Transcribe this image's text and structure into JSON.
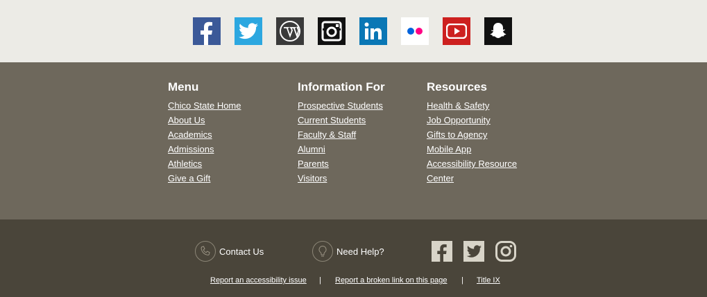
{
  "social_icons": [
    {
      "icon": "facebook-icon",
      "bg": "#3b5998"
    },
    {
      "icon": "twitter-icon",
      "bg": "#2ca7e0"
    },
    {
      "icon": "wordpress-icon",
      "bg": "#3a3a3a"
    },
    {
      "icon": "instagram-icon",
      "bg": "#111111"
    },
    {
      "icon": "linkedin-icon",
      "bg": "#0a77b5"
    },
    {
      "icon": "flickr-icon",
      "bg": "#ffffff"
    },
    {
      "icon": "youtube-icon",
      "bg": "#cd201f"
    },
    {
      "icon": "snapchat-icon",
      "bg": "#111111"
    }
  ],
  "columns": [
    {
      "heading": "Menu",
      "links": [
        "Chico State Home",
        "About Us",
        "Academics",
        "Admissions",
        "Athletics",
        "Give a Gift"
      ]
    },
    {
      "heading": "Information For",
      "links": [
        "Prospective Students",
        "Current Students",
        "Faculty & Staff",
        "Alumni",
        "Parents",
        "Visitors"
      ]
    },
    {
      "heading": "Resources",
      "links": [
        "Health & Safety",
        "Job Opportunity",
        "Gifts to Agency",
        "Mobile App",
        "Accessibility Resource",
        "Center"
      ]
    }
  ],
  "contact": {
    "contact_label": "Contact Us",
    "help_label": "Need Help?"
  },
  "legal": {
    "accessibility": "Report an accessibility issue",
    "broken_link": "Report a broken link on this page",
    "title_ix": "Title IX",
    "separator": "|"
  },
  "colors": {
    "social_bar": "#ecebe6",
    "links_section": "#6e685c",
    "bottom_bar": "#4a453a",
    "small_icon": "#d8d4c8"
  }
}
